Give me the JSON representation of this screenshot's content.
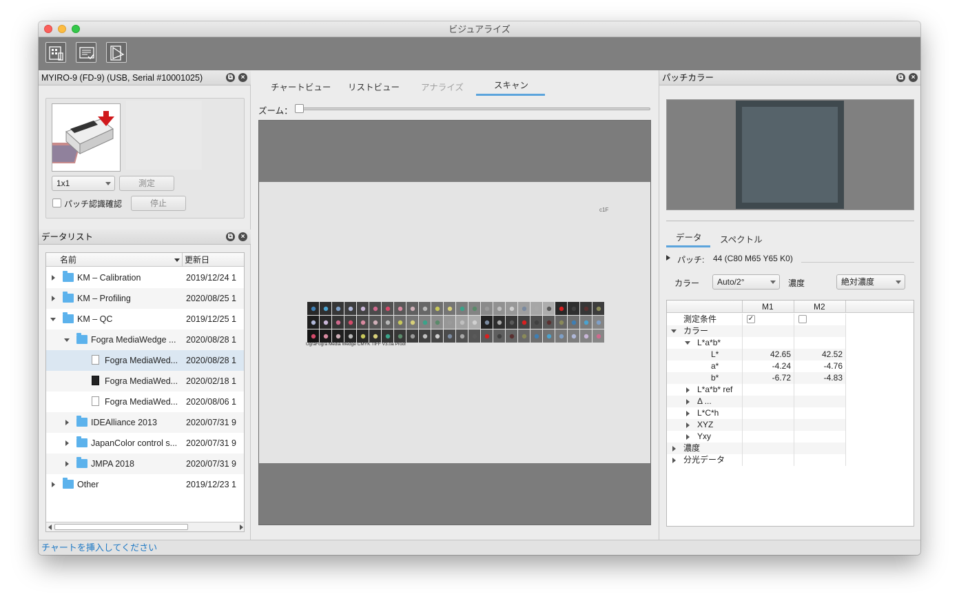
{
  "window": {
    "title": "ビジュアライズ"
  },
  "toolbar": {
    "icons": [
      "chart-grid-icon",
      "list-check-icon",
      "analyze-icon"
    ]
  },
  "device_panel": {
    "title": "MYIRO-9 (FD-9) (USB, Serial #10001025)",
    "patch_size": "1x1",
    "measure_label": "測定",
    "patch_confirm_label": "パッチ認識確認",
    "stop_label": "停止"
  },
  "data_list": {
    "title": "データリスト",
    "col_name": "名前",
    "col_date": "更新日",
    "rows": [
      {
        "name": "KM – Calibration",
        "date": "2019/12/24 1"
      },
      {
        "name": "KM – Profiling",
        "date": "2020/08/25 1"
      },
      {
        "name": "KM – QC",
        "date": "2019/12/25 1"
      },
      {
        "name": "Fogra MediaWedge ...",
        "date": "2020/08/28 1"
      },
      {
        "name": "Fogra MediaWed...",
        "date": "2020/08/28 1"
      },
      {
        "name": "Fogra MediaWed...",
        "date": "2020/02/18 1"
      },
      {
        "name": "Fogra MediaWed...",
        "date": "2020/08/06 1"
      },
      {
        "name": "IDEAlliance 2013",
        "date": "2020/07/31 9"
      },
      {
        "name": "JapanColor control s...",
        "date": "2020/07/31 9"
      },
      {
        "name": "JMPA 2018",
        "date": "2020/07/31 9"
      },
      {
        "name": "Other",
        "date": "2019/12/23 1"
      }
    ]
  },
  "center": {
    "tabs": [
      "チャートビュー",
      "リストビュー",
      "アナライズ",
      "スキャン"
    ],
    "zoom_label": "ズーム：",
    "chart_caption": "UgraFogra Media Wedge CMYK TIFF V3.0a Proof",
    "corner_mark": "c1F"
  },
  "patch_panel": {
    "title": "パッチカラー",
    "swatch_color": "#56636a",
    "tabs": [
      "データ",
      "スペクトル"
    ],
    "patch_label": "パッチ:",
    "patch_value": "44 (C80 M65 Y65 K0)",
    "color_label": "カラー",
    "color_value": "Auto/2°",
    "density_label": "濃度",
    "density_value": "絶対濃度",
    "columns": [
      "M1",
      "M2"
    ],
    "rows": {
      "conditions": "測定条件",
      "color": "カラー",
      "lab": "L*a*b*",
      "L_label": "L*",
      "L_m1": "42.65",
      "L_m2": "42.52",
      "a_label": "a*",
      "a_m1": "-4.24",
      "a_m2": "-4.76",
      "b_label": "b*",
      "b_m1": "-6.72",
      "b_m2": "-4.83",
      "lab_ref": "L*a*b* ref",
      "delta": "Δ ...",
      "lch": "L*C*h",
      "xyz": "XYZ",
      "yxy": "Yxy",
      "density": "濃度",
      "spectral": "分光データ"
    }
  },
  "status": {
    "message": "チャートを挿入してください"
  }
}
